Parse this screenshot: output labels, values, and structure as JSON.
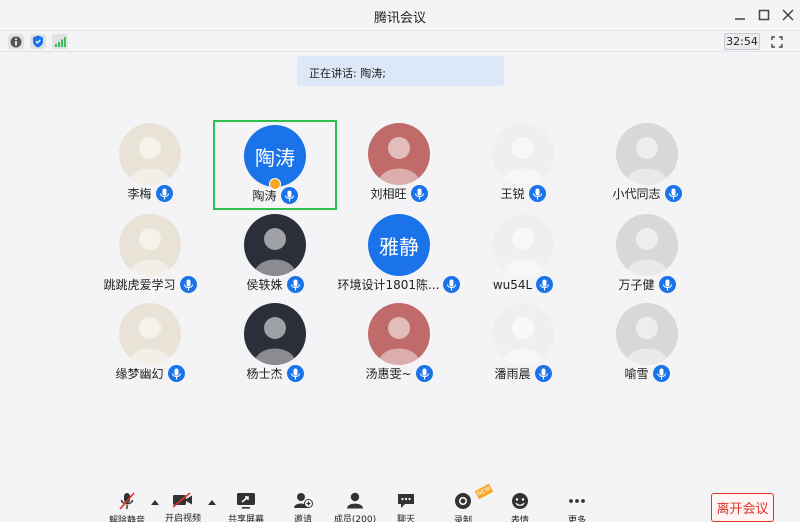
{
  "window": {
    "title": "腾讯会议"
  },
  "infobar": {
    "timer": "32:54"
  },
  "speaking": {
    "label": "正在讲话:",
    "name": "陶涛;"
  },
  "participants": [
    {
      "name": "李梅",
      "avatar": "photo",
      "avatar_icon": "girl-pink-backpack"
    },
    {
      "name": "陶涛",
      "avatar": "initials",
      "initials": "陶涛",
      "speaking": true,
      "host": true
    },
    {
      "name": "刘相旺",
      "avatar": "photo",
      "avatar_icon": "person-red-hat"
    },
    {
      "name": "王锐",
      "avatar": "photo",
      "avatar_icon": "cartoon-grandma"
    },
    {
      "name": "小代同志",
      "avatar": "photo",
      "avatar_icon": "sketch-girl"
    },
    {
      "name": "跳跳虎爱学习",
      "avatar": "photo",
      "avatar_icon": "dark-hair-girl"
    },
    {
      "name": "侯轶姝",
      "avatar": "photo",
      "avatar_icon": "anime-boy"
    },
    {
      "name": "环境设计1801陈...",
      "avatar": "initials",
      "initials": "雅静"
    },
    {
      "name": "wu54L",
      "avatar": "photo",
      "avatar_icon": "dark-scene"
    },
    {
      "name": "万子健",
      "avatar": "photo",
      "avatar_icon": "pop-art-woman"
    },
    {
      "name": "缘梦幽幻",
      "avatar": "photo",
      "avatar_icon": "man-portrait"
    },
    {
      "name": "杨士杰",
      "avatar": "photo",
      "avatar_icon": "girl-with-apple"
    },
    {
      "name": "汤惠雯~",
      "avatar": "photo",
      "avatar_icon": "girl-with-mask"
    },
    {
      "name": "潘雨晨",
      "avatar": "photo",
      "avatar_icon": "pink-hair-girl"
    },
    {
      "name": "喻雪",
      "avatar": "photo",
      "avatar_icon": "gallery-room"
    }
  ],
  "toolbar": {
    "unmute": "解除静音",
    "start_video": "开启视频",
    "share_screen": "共享屏幕",
    "invite": "邀请",
    "members": "成员(200)",
    "chat": "聊天",
    "record": "录制",
    "record_tag": "NEW",
    "emoji": "表情",
    "more": "更多",
    "leave": "离开会议"
  },
  "colors": {
    "accent": "#1a73e8",
    "speaking_border": "#2fbe4f",
    "leave": "#e0332b",
    "host_badge": "#f5a623"
  }
}
